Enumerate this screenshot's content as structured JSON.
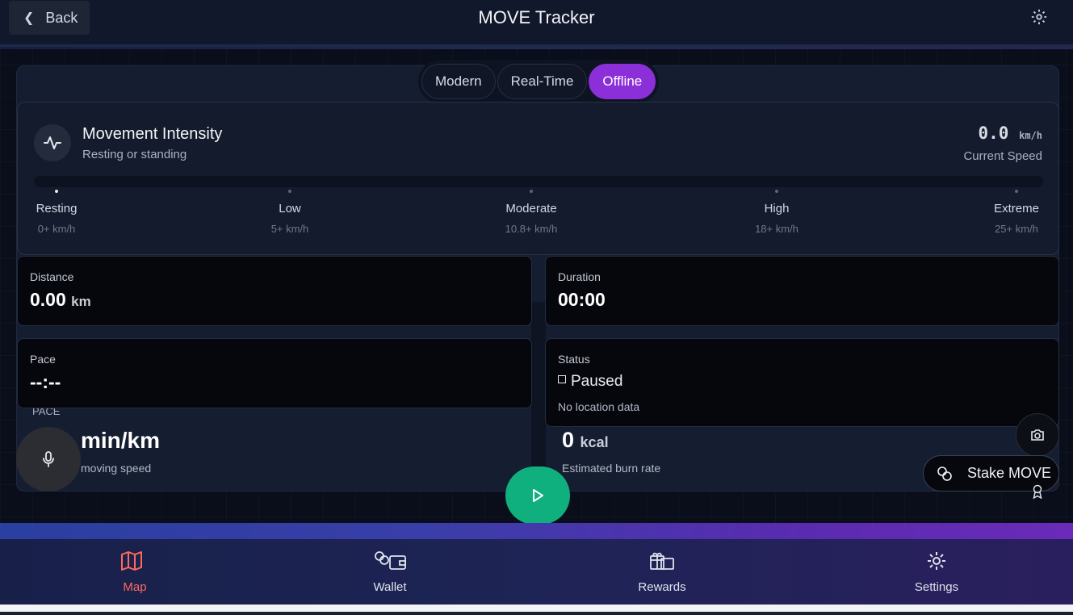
{
  "header": {
    "back_label": "Back",
    "title": "MOVE Tracker"
  },
  "mode_tabs": [
    {
      "label": "Modern",
      "active": false
    },
    {
      "label": "Real-Time",
      "active": false
    },
    {
      "label": "Offline",
      "active": true
    }
  ],
  "intensity": {
    "title": "Movement Intensity",
    "subtitle": "Resting or standing",
    "speed_value": "0.0",
    "speed_unit": "km/h",
    "speed_label": "Current Speed",
    "current_level_index": 0,
    "levels": [
      {
        "name": "Resting",
        "range": "0+ km/h"
      },
      {
        "name": "Low",
        "range": "5+ km/h"
      },
      {
        "name": "Moderate",
        "range": "10.8+ km/h"
      },
      {
        "name": "High",
        "range": "18+ km/h"
      },
      {
        "name": "Extreme",
        "range": "25+ km/h"
      }
    ]
  },
  "stats": {
    "distance": {
      "label": "Distance",
      "value": "0.00",
      "unit": "km"
    },
    "duration": {
      "label": "Duration",
      "value": "00:00"
    },
    "pace": {
      "label": "Pace",
      "value": "--:--"
    },
    "status": {
      "label": "Status",
      "value": "Paused",
      "note": "No location data"
    }
  },
  "lower": {
    "pace_label": "PACE",
    "pace_value_partial": "min/km",
    "pace_sub": "moving speed",
    "kcal_value": "0",
    "kcal_unit": "kcal",
    "kcal_sub": "Estimated burn rate"
  },
  "actions": {
    "stake_label": "Stake MOVE"
  },
  "bottom_nav": [
    {
      "label": "Map",
      "icon": "map-icon",
      "active": true
    },
    {
      "label": "Wallet",
      "icon": "wallet-icon",
      "active": false
    },
    {
      "label": "Rewards",
      "icon": "rewards-icon",
      "active": false
    },
    {
      "label": "Settings",
      "icon": "settings-icon",
      "active": false
    }
  ],
  "colors": {
    "accent_purple": "#8b2fd8",
    "play_green": "#10b07e",
    "nav_active": "#ff6b5a"
  }
}
